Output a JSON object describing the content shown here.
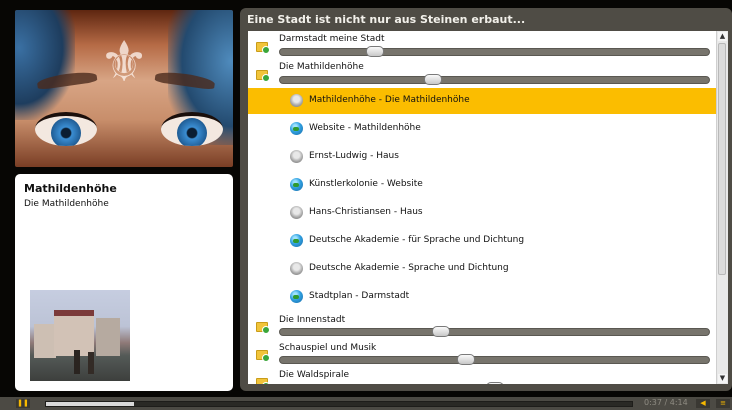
{
  "panel": {
    "title": "Eine Stadt ist nicht nur aus Steinen erbaut..."
  },
  "info": {
    "title": "Mathildenhöhe",
    "subtitle": "Die Mathildenhöhe"
  },
  "categories": [
    {
      "label": "Darmstadt meine Stadt",
      "slider": 0.21
    },
    {
      "label": "Die Mathildenhöhe",
      "slider": 0.35
    },
    {
      "label": "Die Innenstadt",
      "slider": 0.37
    },
    {
      "label": "Schauspiel und Musik",
      "slider": 0.43
    },
    {
      "label": "Die Waldspirale",
      "slider": 0.5
    }
  ],
  "items": [
    {
      "label": "Mathildenhöhe - Die Mathildenhöhe",
      "icon": "bust-icon",
      "selected": true
    },
    {
      "label": "Website - Mathildenhöhe",
      "icon": "globe-icon",
      "selected": false
    },
    {
      "label": "Ernst-Ludwig - Haus",
      "icon": "bust-icon",
      "selected": false
    },
    {
      "label": "Künstlerkolonie - Website",
      "icon": "globe-icon",
      "selected": false
    },
    {
      "label": "Hans-Christiansen - Haus",
      "icon": "bust-icon",
      "selected": false
    },
    {
      "label": "Deutsche Akademie - für Sprache und Dichtung",
      "icon": "globe-icon",
      "selected": false
    },
    {
      "label": "Deutsche Akademie - Sprache und Dichtung",
      "icon": "bust-icon",
      "selected": false
    },
    {
      "label": "Stadtplan - Darmstadt",
      "icon": "globe-icon",
      "selected": false
    }
  ],
  "player": {
    "time": "0:37 / 4:14",
    "progress": 0.15
  },
  "colors": {
    "selected": "#fbbd00",
    "panel": "#4f4c45",
    "accent": "#f6b800"
  }
}
